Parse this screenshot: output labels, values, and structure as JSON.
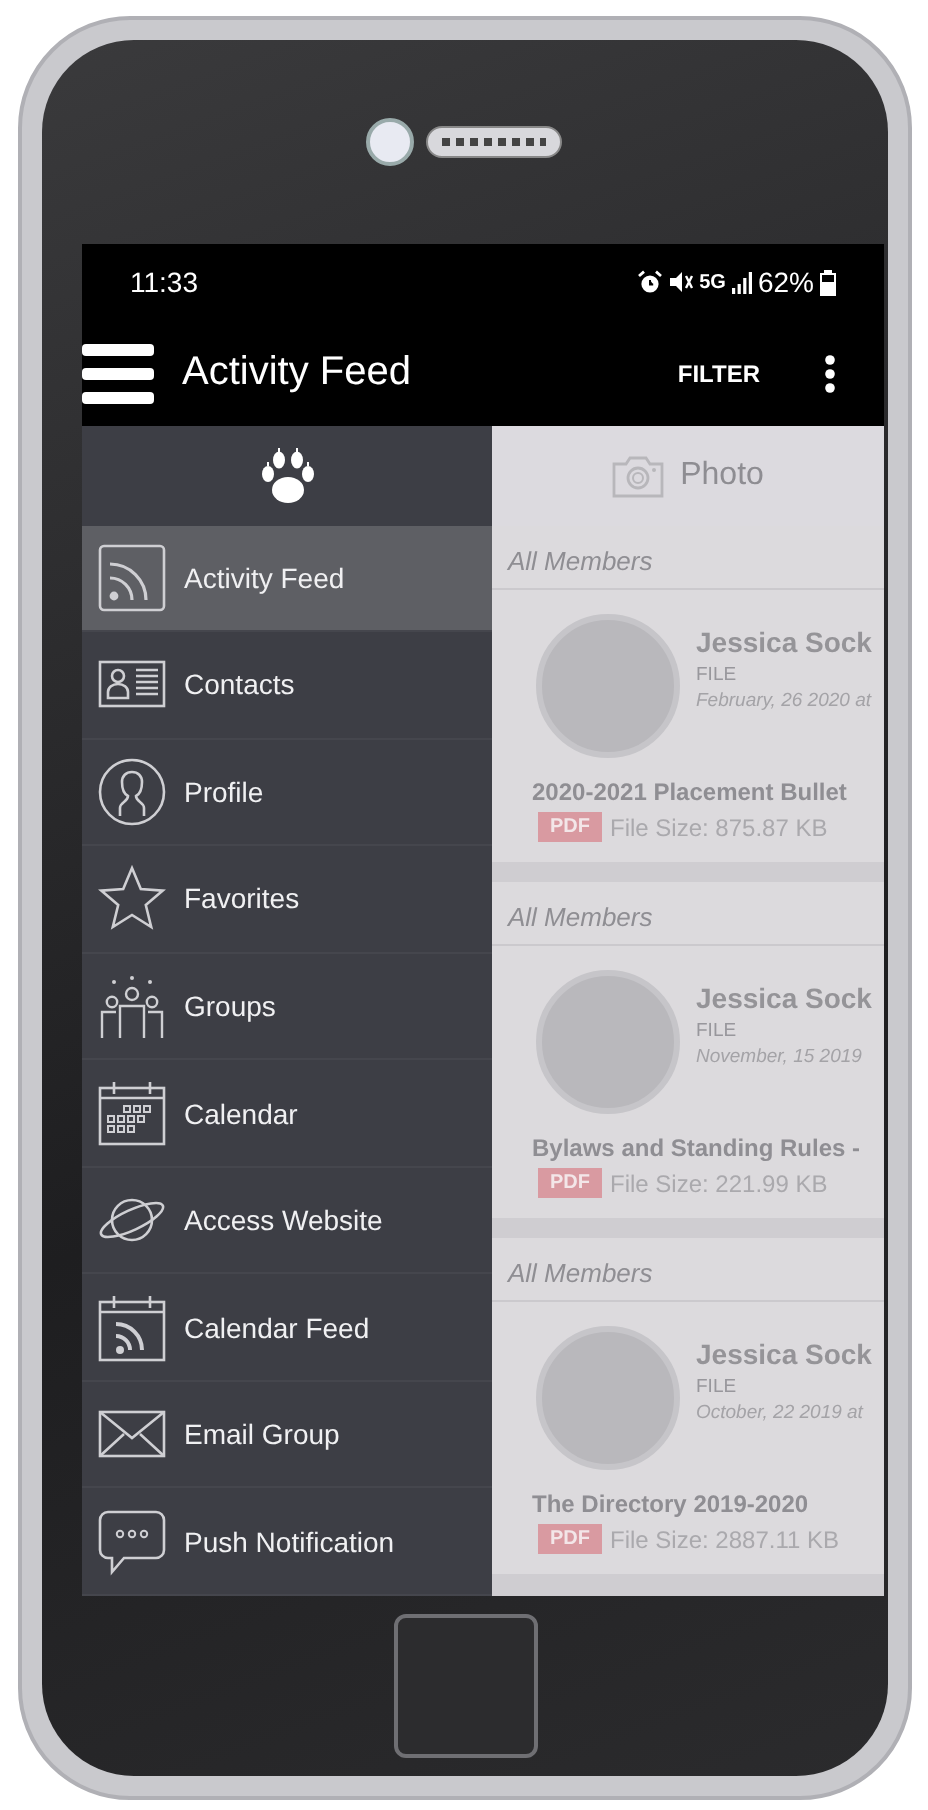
{
  "status_bar": {
    "time": "11:33",
    "network": "5G",
    "battery": "62%"
  },
  "app_bar": {
    "title": "Activity Feed",
    "action": "FILTER"
  },
  "drawer": {
    "items": [
      {
        "label": "Activity Feed",
        "selected": true
      },
      {
        "label": "Contacts",
        "selected": false
      },
      {
        "label": "Profile",
        "selected": false
      },
      {
        "label": "Favorites",
        "selected": false
      },
      {
        "label": "Groups",
        "selected": false
      },
      {
        "label": "Calendar",
        "selected": false
      },
      {
        "label": "Access Website",
        "selected": false
      },
      {
        "label": "Calendar Feed",
        "selected": false
      },
      {
        "label": "Email Group",
        "selected": false
      },
      {
        "label": "Push Notification",
        "selected": false
      }
    ]
  },
  "feed": {
    "photo_button": "Photo",
    "posts": [
      {
        "audience": "All Members",
        "author": "Jessica Sock",
        "type": "FILE",
        "date": "February, 26 2020 at",
        "title": "2020-2021 Placement Bullet",
        "badge": "PDF",
        "size": "File Size: 875.87 KB"
      },
      {
        "audience": "All Members",
        "author": "Jessica Sock",
        "type": "FILE",
        "date": "November, 15 2019",
        "title": "Bylaws and Standing Rules -",
        "badge": "PDF",
        "size": "File Size: 221.99 KB"
      },
      {
        "audience": "All Members",
        "author": "Jessica Sock",
        "type": "FILE",
        "date": "October, 22 2019 at",
        "title": "The Directory 2019-2020",
        "badge": "PDF",
        "size": "File Size: 2887.11 KB"
      }
    ]
  }
}
